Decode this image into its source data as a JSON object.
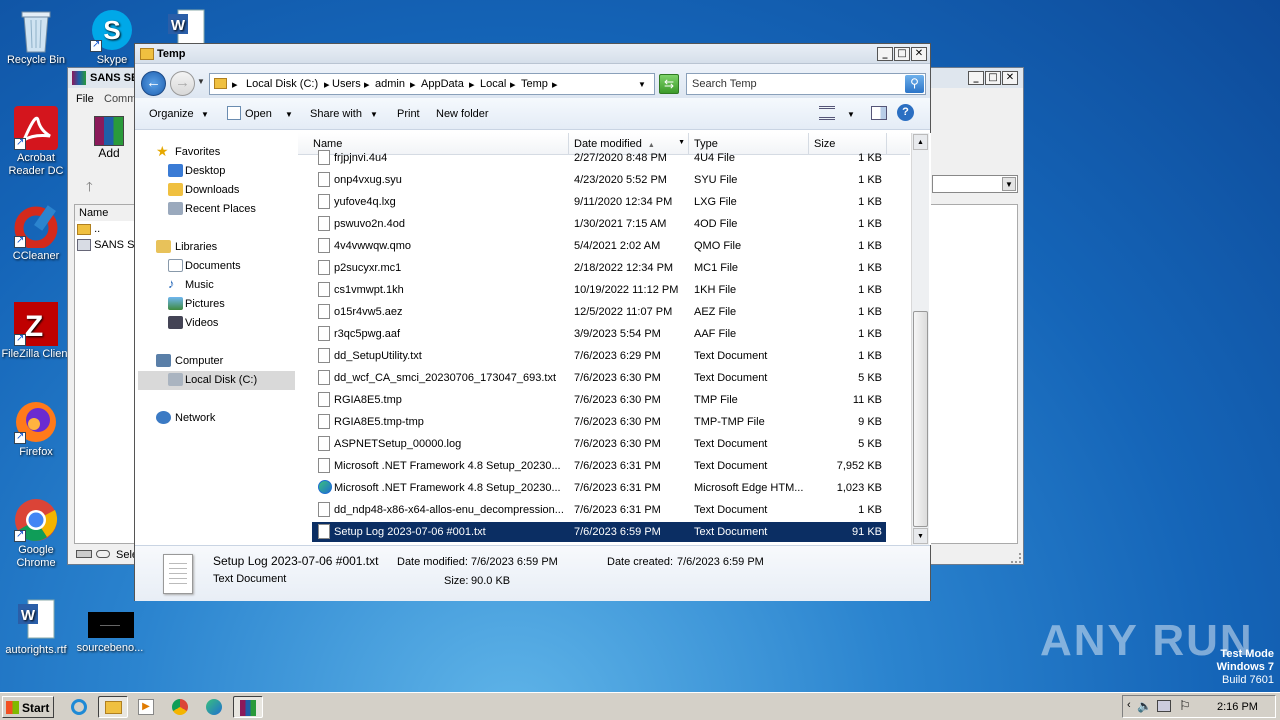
{
  "desktop": {
    "icons": [
      "Recycle Bin",
      "Skype",
      "Acrobat Reader DC",
      "CCleaner",
      "FileZilla Client",
      "Firefox",
      "Google Chrome",
      "autorights.rtf",
      "sourcebeno..."
    ],
    "watermark": {
      "brand": "ANY RUN",
      "line1": "Test Mode",
      "line2": "Windows 7",
      "line3": "Build 7601"
    }
  },
  "winrar": {
    "title": "SANS SE",
    "menu": [
      "File",
      "Comm"
    ],
    "add_label": "Add",
    "col_name": "Name",
    "rows": [
      "..",
      "SANS SE"
    ],
    "status": "Sele"
  },
  "explorer": {
    "title": "Temp",
    "breadcrumb": [
      "Local Disk (C:)",
      "Users",
      "admin",
      "AppData",
      "Local",
      "Temp"
    ],
    "search_placeholder": "Search Temp",
    "toolbar": {
      "organize": "Organize",
      "open": "Open",
      "share_with": "Share with",
      "print": "Print",
      "new_folder": "New folder"
    },
    "nav": {
      "favorites": "Favorites",
      "desktop": "Desktop",
      "downloads": "Downloads",
      "recent": "Recent Places",
      "libraries": "Libraries",
      "documents": "Documents",
      "music": "Music",
      "pictures": "Pictures",
      "videos": "Videos",
      "computer": "Computer",
      "local_disk": "Local Disk (C:)",
      "network": "Network"
    },
    "columns": {
      "name": "Name",
      "date": "Date modified",
      "type": "Type",
      "size": "Size"
    },
    "files": [
      {
        "name": "frjpjnvi.4u4",
        "date": "2/27/2020 8:48 PM",
        "type": "4U4 File",
        "size": "1 KB"
      },
      {
        "name": "onp4vxug.syu",
        "date": "4/23/2020 5:52 PM",
        "type": "SYU File",
        "size": "1 KB"
      },
      {
        "name": "yufove4q.lxg",
        "date": "9/11/2020 12:34 PM",
        "type": "LXG File",
        "size": "1 KB"
      },
      {
        "name": "pswuvo2n.4od",
        "date": "1/30/2021 7:15 AM",
        "type": "4OD File",
        "size": "1 KB"
      },
      {
        "name": "4v4vwwqw.qmo",
        "date": "5/4/2021 2:02 AM",
        "type": "QMO File",
        "size": "1 KB"
      },
      {
        "name": "p2sucyxr.mc1",
        "date": "2/18/2022 12:34 PM",
        "type": "MC1 File",
        "size": "1 KB"
      },
      {
        "name": "cs1vmwpt.1kh",
        "date": "10/19/2022 11:12 PM",
        "type": "1KH File",
        "size": "1 KB"
      },
      {
        "name": "o15r4vw5.aez",
        "date": "12/5/2022 11:07 PM",
        "type": "AEZ File",
        "size": "1 KB"
      },
      {
        "name": "r3qc5pwg.aaf",
        "date": "3/9/2023 5:54 PM",
        "type": "AAF File",
        "size": "1 KB"
      },
      {
        "name": "dd_SetupUtility.txt",
        "date": "7/6/2023 6:29 PM",
        "type": "Text Document",
        "size": "1 KB"
      },
      {
        "name": "dd_wcf_CA_smci_20230706_173047_693.txt",
        "date": "7/6/2023 6:30 PM",
        "type": "Text Document",
        "size": "5 KB"
      },
      {
        "name": "RGIA8E5.tmp",
        "date": "7/6/2023 6:30 PM",
        "type": "TMP File",
        "size": "11 KB"
      },
      {
        "name": "RGIA8E5.tmp-tmp",
        "date": "7/6/2023 6:30 PM",
        "type": "TMP-TMP File",
        "size": "9 KB"
      },
      {
        "name": "ASPNETSetup_00000.log",
        "date": "7/6/2023 6:30 PM",
        "type": "Text Document",
        "size": "5 KB"
      },
      {
        "name": "Microsoft .NET Framework 4.8 Setup_20230...",
        "date": "7/6/2023 6:31 PM",
        "type": "Text Document",
        "size": "7,952 KB"
      },
      {
        "name": "Microsoft .NET Framework 4.8 Setup_20230...",
        "date": "7/6/2023 6:31 PM",
        "type": "Microsoft Edge HTM...",
        "size": "1,023 KB"
      },
      {
        "name": "dd_ndp48-x86-x64-allos-enu_decompression...",
        "date": "7/6/2023 6:31 PM",
        "type": "Text Document",
        "size": "1 KB"
      },
      {
        "name": "Setup Log 2023-07-06 #001.txt",
        "date": "7/6/2023 6:59 PM",
        "type": "Text Document",
        "size": "91 KB"
      }
    ],
    "details": {
      "name": "Setup Log 2023-07-06 #001.txt",
      "kind": "Text Document",
      "modified_label": "Date modified:",
      "modified": "7/6/2023 6:59 PM",
      "created_label": "Date created:",
      "created": "7/6/2023 6:59 PM",
      "size_label": "Size:",
      "size": "90.0 KB"
    }
  },
  "taskbar": {
    "start": "Start",
    "clock": "2:16 PM"
  }
}
